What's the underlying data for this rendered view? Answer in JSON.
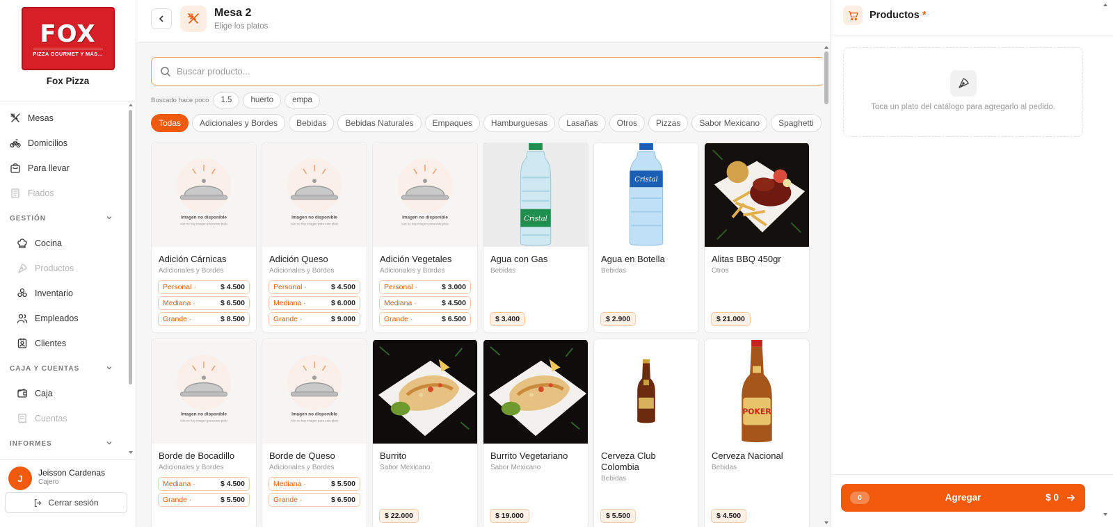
{
  "brand": {
    "logo_word": "FOX",
    "logo_tagline": "PIZZA GOURMET Y MÁS...",
    "name": "Fox Pizza"
  },
  "sidebar": {
    "items": [
      {
        "label": "Mesas",
        "icon": "utensils-icon",
        "disabled": false
      },
      {
        "label": "Domicilios",
        "icon": "bike-icon",
        "disabled": false
      },
      {
        "label": "Para llevar",
        "icon": "bag-icon",
        "disabled": false
      },
      {
        "label": "Fiados",
        "icon": "notebook-icon",
        "disabled": true
      }
    ],
    "sections": [
      {
        "title": "GESTIÓN",
        "items": [
          {
            "label": "Cocina",
            "icon": "chef-hat-icon",
            "disabled": false
          },
          {
            "label": "Productos",
            "icon": "pizza-icon",
            "disabled": true
          },
          {
            "label": "Inventario",
            "icon": "boxes-icon",
            "disabled": false
          },
          {
            "label": "Empleados",
            "icon": "users-icon",
            "disabled": false
          },
          {
            "label": "Clientes",
            "icon": "contact-icon",
            "disabled": false
          }
        ]
      },
      {
        "title": "CAJA Y CUENTAS",
        "items": [
          {
            "label": "Caja",
            "icon": "wallet-icon",
            "disabled": false
          },
          {
            "label": "Cuentas",
            "icon": "receipt-icon",
            "disabled": true
          }
        ]
      },
      {
        "title": "INFORMES",
        "items": []
      }
    ]
  },
  "user": {
    "initial": "J",
    "name": "Jeisson Cardenas",
    "role": "Cajero",
    "logout_label": "Cerrar sesión"
  },
  "header": {
    "title": "Mesa 2",
    "subtitle": "Elige los platos"
  },
  "search": {
    "placeholder": "Buscar producto...",
    "value": ""
  },
  "recent": {
    "label": "Buscado hace poco",
    "chips": [
      "1.5",
      "huerto",
      "empa"
    ]
  },
  "categories": [
    "Todas",
    "Adicionales y Bordes",
    "Bebidas",
    "Bebidas Naturales",
    "Empaques",
    "Hamburguesas",
    "Lasañas",
    "Otros",
    "Pizzas",
    "Sabor Mexicano",
    "Spaghetti"
  ],
  "active_category": "Todas",
  "placeholder_image": {
    "title": "Imagen no disponible",
    "subtitle": "Aún no hay imagen para este plato"
  },
  "products": [
    {
      "name": "Adición Cárnicas",
      "category": "Adicionales y Bordes",
      "image": "placeholder",
      "sizes": [
        {
          "label": "Personal",
          "price": "$ 4.500"
        },
        {
          "label": "Mediana",
          "price": "$ 6.500"
        },
        {
          "label": "Grande",
          "price": "$ 8.500"
        }
      ]
    },
    {
      "name": "Adición Queso",
      "category": "Adicionales y Bordes",
      "image": "placeholder",
      "sizes": [
        {
          "label": "Personal",
          "price": "$ 4.500"
        },
        {
          "label": "Mediana",
          "price": "$ 6.000"
        },
        {
          "label": "Grande",
          "price": "$ 9.000"
        }
      ]
    },
    {
      "name": "Adición Vegetales",
      "category": "Adicionales y Bordes",
      "image": "placeholder",
      "sizes": [
        {
          "label": "Personal",
          "price": "$ 3.000"
        },
        {
          "label": "Mediana",
          "price": "$ 4.500"
        },
        {
          "label": "Grande",
          "price": "$ 6.500"
        }
      ]
    },
    {
      "name": "Agua con Gas",
      "category": "Bebidas",
      "image": "water-green",
      "price": "$ 3.400"
    },
    {
      "name": "Agua en Botella",
      "category": "Bebidas",
      "image": "water-blue",
      "price": "$ 2.900"
    },
    {
      "name": "Alitas BBQ 450gr",
      "category": "Otros",
      "image": "wings",
      "price": "$ 21.000"
    },
    {
      "name": "Borde de Bocadillo",
      "category": "Adicionales y Bordes",
      "image": "placeholder",
      "sizes": [
        {
          "label": "Mediana",
          "price": "$ 4.500"
        },
        {
          "label": "Grande",
          "price": "$ 5.500"
        }
      ]
    },
    {
      "name": "Borde de Queso",
      "category": "Adicionales y Bordes",
      "image": "placeholder",
      "sizes": [
        {
          "label": "Mediana",
          "price": "$ 5.500"
        },
        {
          "label": "Grande",
          "price": "$ 6.500"
        }
      ]
    },
    {
      "name": "Burrito",
      "category": "Sabor Mexicano",
      "image": "burrito",
      "price": "$ 22.000"
    },
    {
      "name": "Burrito Vegetariano",
      "category": "Sabor Mexicano",
      "image": "burrito",
      "price": "$ 19.000"
    },
    {
      "name": "Cerveza Club Colombia",
      "category": "Bebidas",
      "image": "beer-club",
      "price": "$ 5.500"
    },
    {
      "name": "Cerveza Nacional",
      "category": "Bebidas",
      "image": "beer-poker",
      "price": "$ 4.500"
    }
  ],
  "cart": {
    "title": "Productos",
    "required_mark": "*",
    "empty_text": "Toca un plato del catálogo para agregarlo al pedido.",
    "count": "0",
    "add_label": "Agregar",
    "total": "$ 0"
  },
  "colors": {
    "accent": "#f25a0b",
    "brand_red": "#d61f26"
  }
}
